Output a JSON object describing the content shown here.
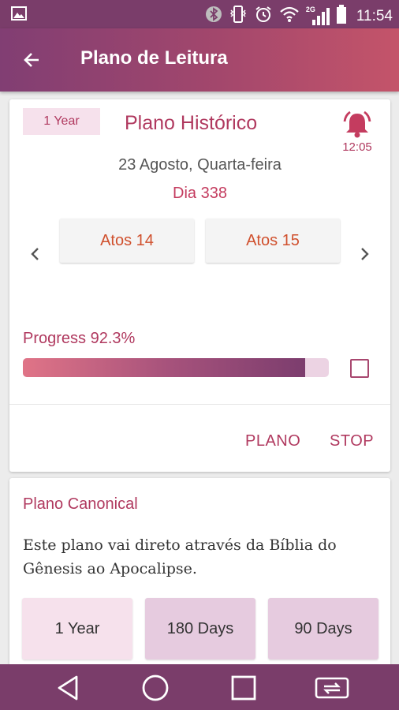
{
  "status_bar": {
    "time": "11:54",
    "network_label": "2G",
    "icons": [
      "image-icon",
      "bluetooth-icon",
      "vibrate-icon",
      "alarm-icon",
      "wifi-icon",
      "signal-icon",
      "battery-icon"
    ]
  },
  "app_bar": {
    "title": "Plano de Leitura",
    "back_icon": "arrow-back-icon"
  },
  "plan_card": {
    "badge": "1 Year",
    "title": "Plano Histórico",
    "alarm_time": "12:05",
    "date": "23 Agosto, Quarta-feira",
    "day": "Dia 338",
    "readings": [
      "Atos 14",
      "Atos 15"
    ],
    "progress_label": "Progress 92.3%",
    "progress_value": 0.923,
    "completed": false,
    "actions": {
      "plano": "PLANO",
      "stop": "STOP"
    }
  },
  "canonical_card": {
    "title": "Plano Canonical",
    "description": "Este plano vai direto através da Bíblia do Gênesis ao Apocalipse.",
    "durations": [
      "1 Year",
      "180 Days",
      "90 Days"
    ]
  },
  "colors": {
    "primary": "#7a3d6a",
    "accent": "#b0395f",
    "reading_text": "#d0502d",
    "gradient_start": "#813e73",
    "gradient_end": "#c4546a"
  }
}
